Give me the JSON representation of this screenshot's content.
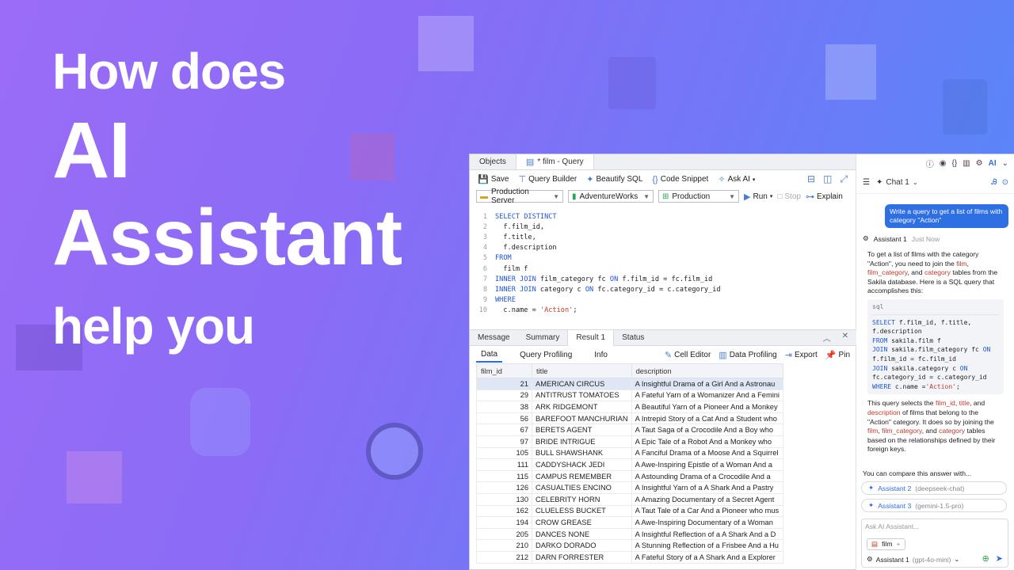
{
  "colors": {
    "accent": "#2d6cdf",
    "keyword": "#1f55d6",
    "string": "#c0392b"
  },
  "hero": {
    "line1": "How does",
    "line2": "AI",
    "line3": "Assistant",
    "line4": "help you"
  },
  "tabs": [
    {
      "label": "Objects"
    },
    {
      "label": "* film - Query",
      "icon": "query-icon"
    }
  ],
  "toolbar": {
    "save": "Save",
    "query_builder": "Query Builder",
    "beautify": "Beautify SQL",
    "snippet": "Code Snippet",
    "ask_ai": "Ask AI"
  },
  "selectors": {
    "server": "Production Server",
    "database": "AdventureWorks",
    "schema": "Production",
    "run": "Run",
    "stop": "Stop",
    "explain": "Explain"
  },
  "editor": {
    "lines": [
      {
        "n": "1",
        "kw": "SELECT DISTINCT",
        "rest": ""
      },
      {
        "n": "2",
        "kw": "",
        "rest": "  f.film_id,"
      },
      {
        "n": "3",
        "kw": "",
        "rest": "  f.title,"
      },
      {
        "n": "4",
        "kw": "",
        "rest": "  f.description"
      },
      {
        "n": "5",
        "kw": "FROM",
        "rest": ""
      },
      {
        "n": "6",
        "kw": "",
        "rest": "  film f"
      },
      {
        "n": "7",
        "kw": "INNER JOIN",
        "rest": " film_category fc ",
        "kw2": "ON",
        "rest2": " f.film_id = fc.film_id"
      },
      {
        "n": "8",
        "kw": "INNER JOIN",
        "rest": " category c ",
        "kw2": "ON",
        "rest2": " fc.category_id = c.category_id"
      },
      {
        "n": "9",
        "kw": "WHERE",
        "rest": ""
      },
      {
        "n": "10",
        "kw": "",
        "rest": "  c.name = ",
        "str": "'Action'",
        "rest2": ";"
      }
    ]
  },
  "result_tabs": {
    "message": "Message",
    "summary": "Summary",
    "result": "Result 1",
    "status": "Status"
  },
  "sub_tabs": {
    "data": "Data",
    "profiling": "Query Profiling",
    "info": "Info",
    "cell_editor": "Cell Editor",
    "data_profiling": "Data Profiling",
    "export": "Export",
    "pin": "Pin"
  },
  "table": {
    "columns": [
      "film_id",
      "title",
      "description"
    ],
    "rows": [
      [
        "21",
        "AMERICAN CIRCUS",
        "A Insightful Drama of a Girl And a Astronau"
      ],
      [
        "29",
        "ANTITRUST TOMATOES",
        "A Fateful Yarn of a Womanizer And a Femini"
      ],
      [
        "38",
        "ARK RIDGEMONT",
        "A Beautiful Yarn of a Pioneer And a Monkey"
      ],
      [
        "56",
        "BAREFOOT MANCHURIAN",
        "A Intrepid Story of a Cat And a Student who"
      ],
      [
        "67",
        "BERETS AGENT",
        "A Taut Saga of a Crocodile And a Boy who"
      ],
      [
        "97",
        "BRIDE INTRIGUE",
        "A Epic Tale of a Robot And a Monkey who"
      ],
      [
        "105",
        "BULL SHAWSHANK",
        "A Fanciful Drama of a Moose And a Squirrel"
      ],
      [
        "111",
        "CADDYSHACK JEDI",
        "A Awe-Inspiring Epistle of a Woman And a"
      ],
      [
        "115",
        "CAMPUS REMEMBER",
        "A Astounding Drama of a Crocodile And a"
      ],
      [
        "126",
        "CASUALTIES ENCINO",
        "A Insightful Yarn of a A Shark And a Pastry"
      ],
      [
        "130",
        "CELEBRITY HORN",
        "A Amazing Documentary of a Secret Agent"
      ],
      [
        "162",
        "CLUELESS BUCKET",
        "A Taut Tale of a Car And a Pioneer who mus"
      ],
      [
        "194",
        "CROW GREASE",
        "A Awe-Inspiring Documentary of a Woman"
      ],
      [
        "205",
        "DANCES NONE",
        "A Insightful Reflection of a A Shark And a D"
      ],
      [
        "210",
        "DARKO DORADO",
        "A Stunning Reflection of a Frisbee And a Hu"
      ],
      [
        "212",
        "DARN FORRESTER",
        "A Fateful Story of a A Shark And a Explorer"
      ]
    ]
  },
  "chat": {
    "title": "Chat 1",
    "user_message": "Write a query to get a list of films with category \"Action\"",
    "assistant_name": "Assistant 1",
    "assistant_time": "Just Now",
    "p1_a": "To get a list of films with the category \"Action\", you need to join the ",
    "p1_film": "film",
    "p1_b": ", ",
    "p1_fc": "film_category",
    "p1_c": ", and ",
    "p1_cat": "category",
    "p1_d": " tables from the Sakila database. Here is a SQL query that accomplishes this:",
    "code_lang": "sql",
    "code_l1_kw": "SELECT",
    "code_l1": " f.film_id, f.title,",
    "code_l2": "f.description",
    "code_l3_kw": "FROM",
    "code_l3": " sakila.film f",
    "code_l4_kw": "JOIN",
    "code_l4": " sakila.film_category fc ",
    "code_l4_kw2": "ON",
    "code_l5": "f.film_id = fc.film_id",
    "code_l6_kw": "JOIN",
    "code_l6": " sakila.category c ",
    "code_l6_kw2": "ON",
    "code_l7": "fc.category_id = c.category_id",
    "code_l8_kw": "WHERE",
    "code_l8": " c.name =",
    "code_l8_str": "'Action'",
    "code_l8_end": ";",
    "p2_a": "This query selects the ",
    "p2_id": "film_id",
    "p2_b": ", ",
    "p2_title": "title",
    "p2_c": ", and ",
    "p2_desc": "description",
    "p2_d": " of films that belong to the \"Action\" category. It does so by joining the ",
    "p2_film": "film",
    "p2_e": ", ",
    "p2_fc": "film_category",
    "p2_f": ", and ",
    "p2_cat": "category",
    "p2_g": " tables based on the relationships defined by their foreign keys.",
    "compare_text": "You can compare this answer with...",
    "alt1_name": "Assistant 2",
    "alt1_model": "(deepseek-chat)",
    "alt2_name": "Assistant 3",
    "alt2_model": "(gemini-1.5-pro)",
    "input_placeholder": "Ask AI Assistant...",
    "chip_label": "film",
    "selected_assistant": "Assistant 1",
    "selected_model": "(gpt-4o-mini)"
  },
  "rtop": {
    "ai_label": "AI"
  }
}
